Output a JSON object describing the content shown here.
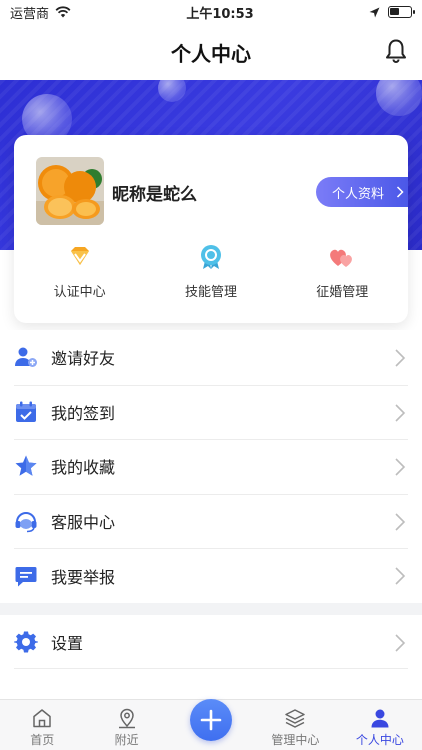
{
  "status_bar": {
    "carrier": "运营商",
    "time": "上午10:53"
  },
  "header": {
    "title": "个人中心"
  },
  "profile": {
    "nickname": "昵称是蛇么",
    "profile_button": "个人资料"
  },
  "features": [
    {
      "label": "认证中心",
      "icon": "diamond-icon"
    },
    {
      "label": "技能管理",
      "icon": "badge-icon"
    },
    {
      "label": "征婚管理",
      "icon": "hearts-icon"
    }
  ],
  "menu": [
    {
      "label": "邀请好友",
      "icon": "invite-user-icon"
    },
    {
      "label": "我的签到",
      "icon": "calendar-check-icon"
    },
    {
      "label": "我的收藏",
      "icon": "star-icon"
    },
    {
      "label": "客服中心",
      "icon": "headset-icon"
    },
    {
      "label": "我要举报",
      "icon": "report-chat-icon"
    }
  ],
  "settings": {
    "label": "设置",
    "icon": "gear-icon"
  },
  "tabbar": [
    {
      "label": "首页",
      "icon": "home-icon"
    },
    {
      "label": "附近",
      "icon": "location-pin-icon"
    },
    {
      "label": "",
      "icon": "plus-icon"
    },
    {
      "label": "管理中心",
      "icon": "layers-icon"
    },
    {
      "label": "个人中心",
      "icon": "person-icon",
      "active": true
    }
  ],
  "colors": {
    "banner": "#2d2fd4",
    "accent": "#3a48e0",
    "profile_button": "#5a63ee"
  }
}
